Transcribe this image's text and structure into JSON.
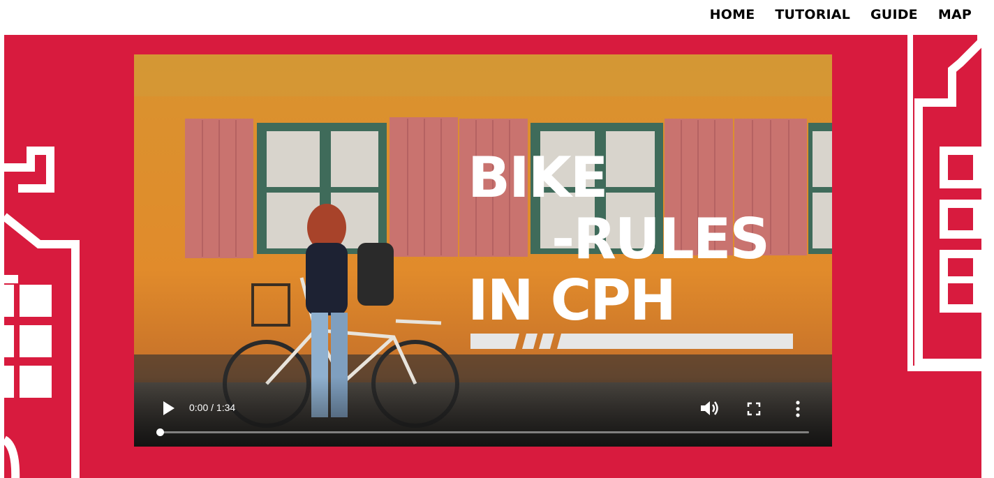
{
  "nav": {
    "items": [
      {
        "label": "HOME"
      },
      {
        "label": "TUTORIAL"
      },
      {
        "label": "GUIDE"
      },
      {
        "label": "MAP"
      }
    ]
  },
  "colors": {
    "brand_red": "#d81b3e",
    "wall_orange": "#e08a2c",
    "shutter_pink": "#c9736f",
    "frame_green": "#3f6b5a"
  },
  "video": {
    "title_lines": [
      "BIKE",
      "-RULES",
      "IN CPH"
    ],
    "current_time": "0:00",
    "separator": " / ",
    "duration": "1:34",
    "progress_fraction": 0,
    "icons": {
      "play": "play-icon",
      "volume": "volume-icon",
      "fullscreen": "fullscreen-icon",
      "more": "more-options-icon"
    }
  }
}
